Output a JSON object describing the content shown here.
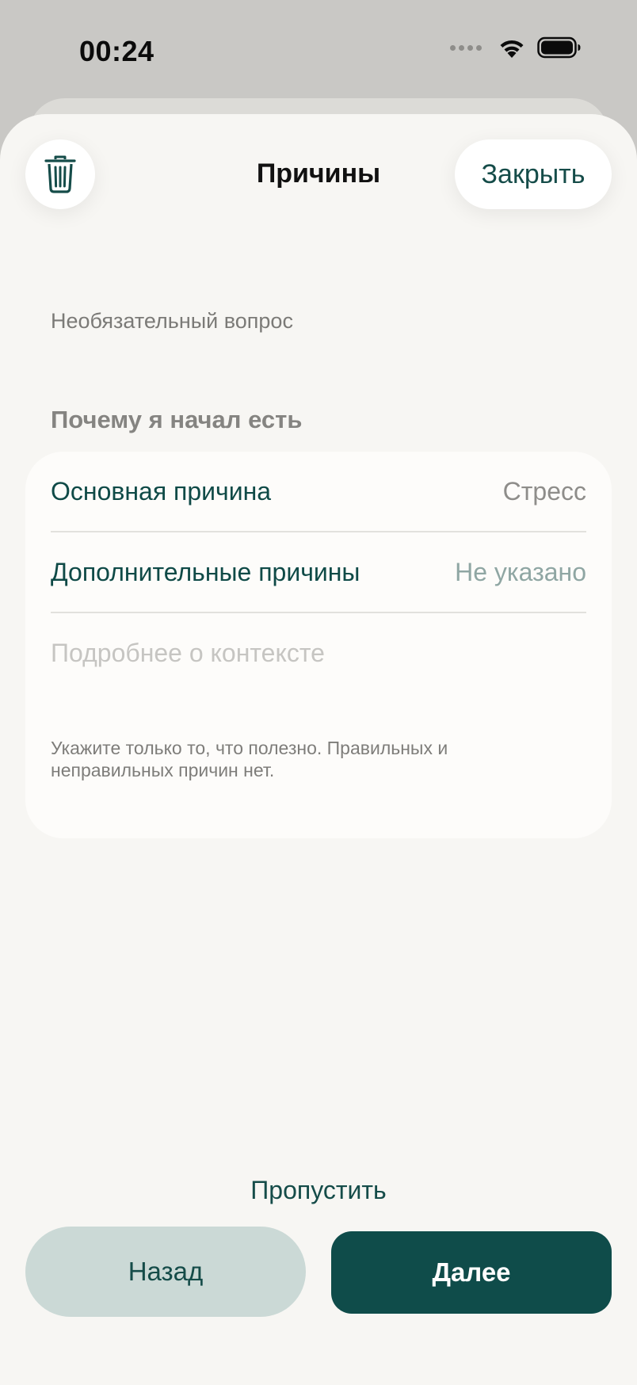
{
  "status_bar": {
    "time": "00:24",
    "icons": [
      "signal-dots-icon",
      "wifi-icon",
      "battery-icon"
    ]
  },
  "header": {
    "delete_icon": "trash-icon",
    "title": "Причины",
    "close_label": "Закрыть"
  },
  "form": {
    "optional_label": "Необязательный вопрос",
    "section_title": "Почему я начал есть",
    "rows": [
      {
        "label": "Основная причина",
        "value": "Стресс"
      },
      {
        "label": "Дополнительные причины",
        "value": "Не указано"
      }
    ],
    "context_placeholder": "Подробнее о контексте",
    "hint": "Укажите только то, что полезно. Правильных и неправильных причин нет."
  },
  "footer": {
    "skip_label": "Пропустить",
    "back_label": "Назад",
    "next_label": "Далее"
  },
  "colors": {
    "accent": "#0f4c4a",
    "accent_light": "#cbd9d6",
    "sheet_background": "#f7f6f3",
    "card_background": "#fdfcfa"
  }
}
